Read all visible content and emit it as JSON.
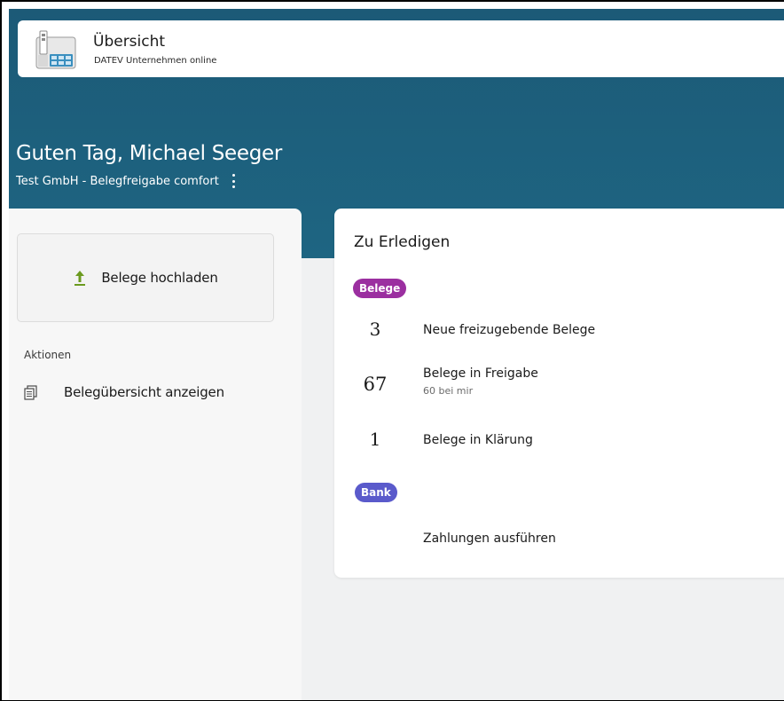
{
  "header": {
    "title": "Übersicht",
    "subtitle": "DATEV Unternehmen online",
    "icon": "datev-app-icon"
  },
  "hero": {
    "greeting": "Guten Tag, Michael Seeger",
    "company": "Test GmbH - Belegfreigabe comfort"
  },
  "sidebar": {
    "upload_label": "Belege hochladen",
    "section_label": "Aktionen",
    "actions": [
      {
        "label": "Belegübersicht anzeigen",
        "icon": "documents-icon"
      }
    ]
  },
  "todo": {
    "title": "Zu Erledigen",
    "groups": [
      {
        "badge": "Belege",
        "items": [
          {
            "count": "3",
            "label": "Neue freizugebende Belege"
          },
          {
            "count": "67",
            "label": "Belege in Freigabe",
            "sub": "60 bei mir"
          },
          {
            "count": "1",
            "label": "Belege in Klärung"
          }
        ]
      },
      {
        "badge": "Bank",
        "items": [
          {
            "count": "",
            "label": "Zahlungen ausführen"
          }
        ]
      }
    ]
  },
  "colors": {
    "hero": "#1e6582",
    "badge_belege": "#9b2fa0",
    "badge_bank": "#5a5acb",
    "upload_arrow": "#6b9a1f"
  }
}
